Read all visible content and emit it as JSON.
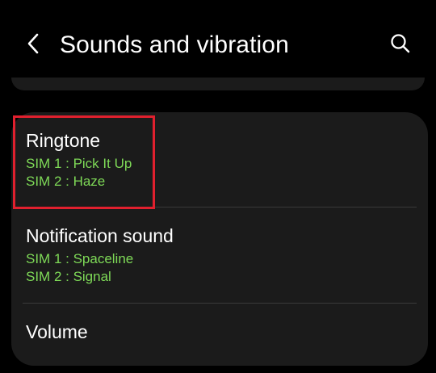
{
  "header": {
    "title": "Sounds and vibration",
    "back_icon": "chevron-left-icon",
    "search_icon": "search-icon"
  },
  "settings": {
    "ringtone": {
      "label": "Ringtone",
      "sim1": "SIM 1 : Pick It Up",
      "sim2": "SIM 2 : Haze"
    },
    "notification_sound": {
      "label": "Notification sound",
      "sim1": "SIM 1 : Spaceline",
      "sim2": "SIM 2 : Signal"
    },
    "volume": {
      "label": "Volume"
    }
  },
  "colors": {
    "background": "#000000",
    "card": "#1b1b1b",
    "accent_green": "#7ed957",
    "highlight_red": "#e0202e"
  }
}
